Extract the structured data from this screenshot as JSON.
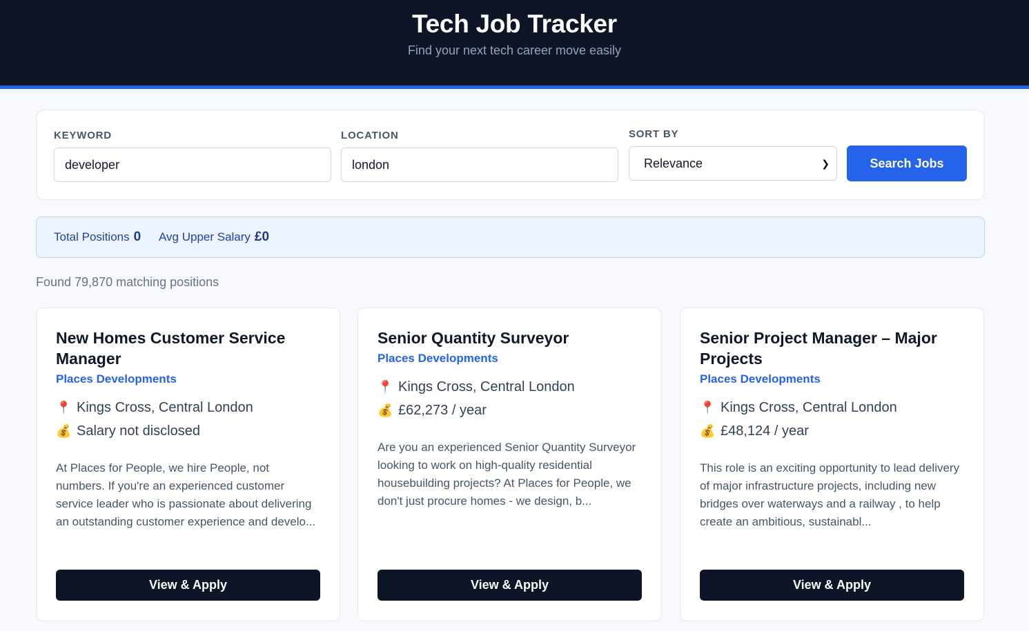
{
  "header": {
    "title": "Tech Job Tracker",
    "subtitle": "Find your next tech career move easily"
  },
  "search": {
    "keyword_label": "KEYWORD",
    "keyword_value": "developer",
    "location_label": "LOCATION",
    "location_value": "london",
    "sort_label": "SORT BY",
    "sort_value": "Relevance",
    "button_label": "Search Jobs"
  },
  "stats": {
    "total_label": "Total Positions",
    "total_value": "0",
    "avg_label": "Avg Upper Salary",
    "avg_value": "£0"
  },
  "results": {
    "found_text": "Found 79,870 matching positions"
  },
  "jobs": [
    {
      "title": "New Homes Customer Service Manager",
      "company": "Places Developments",
      "location": "Kings Cross, Central London",
      "salary": "Salary not disclosed",
      "description": "At Places for People, we hire People, not numbers. If you're an experienced customer service leader who is passionate about delivering an outstanding customer experience and develo...",
      "button": "View & Apply"
    },
    {
      "title": "Senior Quantity Surveyor",
      "company": "Places Developments",
      "location": "Kings Cross, Central London",
      "salary": "£62,273 / year",
      "description": "Are you an experienced Senior Quantity Surveyor looking to work on high-quality residential housebuilding projects? At Places for People, we don't just procure homes - we design, b...",
      "button": "View & Apply"
    },
    {
      "title": "Senior Project Manager – Major Projects",
      "company": "Places Developments",
      "location": "Kings Cross, Central London",
      "salary": "£48,124 / year",
      "description": "This role is an exciting opportunity to lead delivery of major infrastructure projects, including new bridges over waterways and a railway , to help create an ambitious, sustainabl...",
      "button": "View & Apply"
    }
  ],
  "icons": {
    "location": "map-pin-icon",
    "salary": "money-bag-icon"
  },
  "colors": {
    "header_bg": "#0d1526",
    "accent": "#2563eb",
    "button_dark": "#0d1526"
  }
}
